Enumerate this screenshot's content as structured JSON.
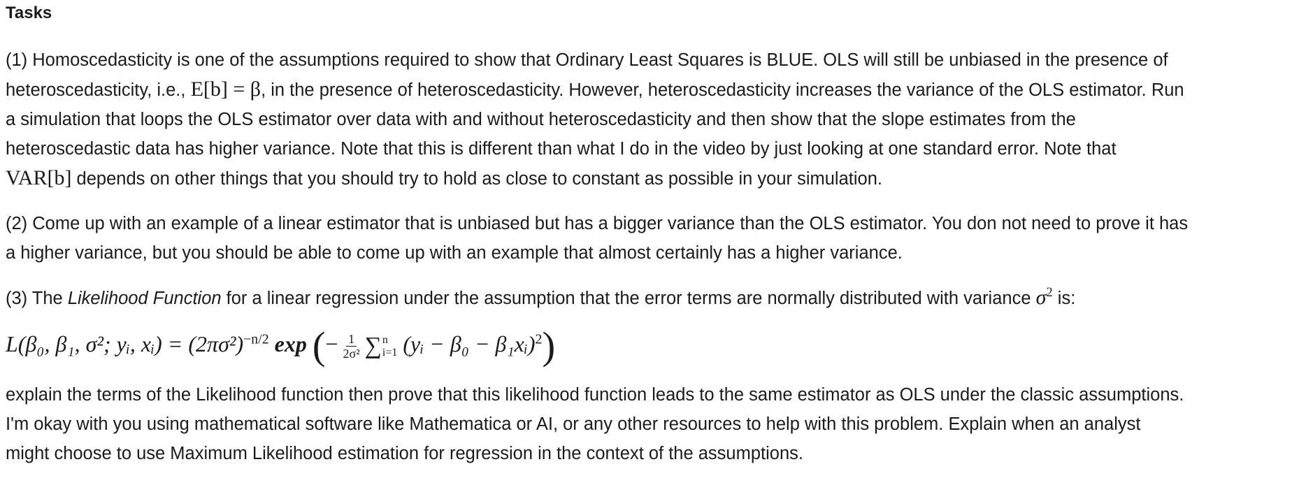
{
  "heading": "Tasks",
  "task1": {
    "line1": "(1) Homoscedasticity is one of the assumptions required to show that Ordinary Least Squares is BLUE. OLS will still be unbiased in the presence of",
    "line2_pre": "heteroscedasticity, i.e., ",
    "line2_math": "E[b] = β",
    "line2_post": ", in the presence of heteroscedasticity. However, heteroscedasticity increases the variance of the OLS estimator. Run",
    "line3": "a simulation that loops the OLS estimator over data with and without heteroscedasticity and then show that the slope estimates from the",
    "line4": "heteroscedastic data has higher variance. Note that this is different than what I do in the video by just looking at one standard error. Note that",
    "line5_math": "VAR[b]",
    "line5_post": " depends on other things that you should try to hold as close to constant as possible in your simulation."
  },
  "task2": {
    "line1": "(2) Come up with an example of a linear estimator that is unbiased but has a bigger variance than the OLS estimator. You don not need to prove it has",
    "line2": "a higher variance, but you should be able to come up with an example that almost certainly has a higher variance."
  },
  "task3": {
    "pre": "(3) The ",
    "emph": "Likelihood Function",
    "post": " for a linear regression under the assumption that the error terms are normally distributed with variance ",
    "var_symbol": "σ",
    "var_exp": "2",
    "end": " is:"
  },
  "equation": {
    "lhs": "L(β₀, β₁, σ²; yᵢ, xᵢ) = (2πσ²)",
    "exponent": "−n/2",
    "exp_word": "exp",
    "frac_num": "1",
    "frac_den": "2σ²",
    "sum_upper": "n",
    "sum_lower": "i=1",
    "summand": "(yᵢ − β₀ − β₁xᵢ)",
    "summand_exp": "2"
  },
  "task3_followup": {
    "line1": "explain the terms of the Likelihood function then prove that this likelihood function leads to the same estimator as OLS under the classic assumptions.",
    "line2": "I'm okay with you using mathematical software like Mathematica or AI, or any other resources to help with this problem. Explain when an analyst",
    "line3": "might choose to use Maximum Likelihood estimation for regression in the context of the assumptions."
  }
}
